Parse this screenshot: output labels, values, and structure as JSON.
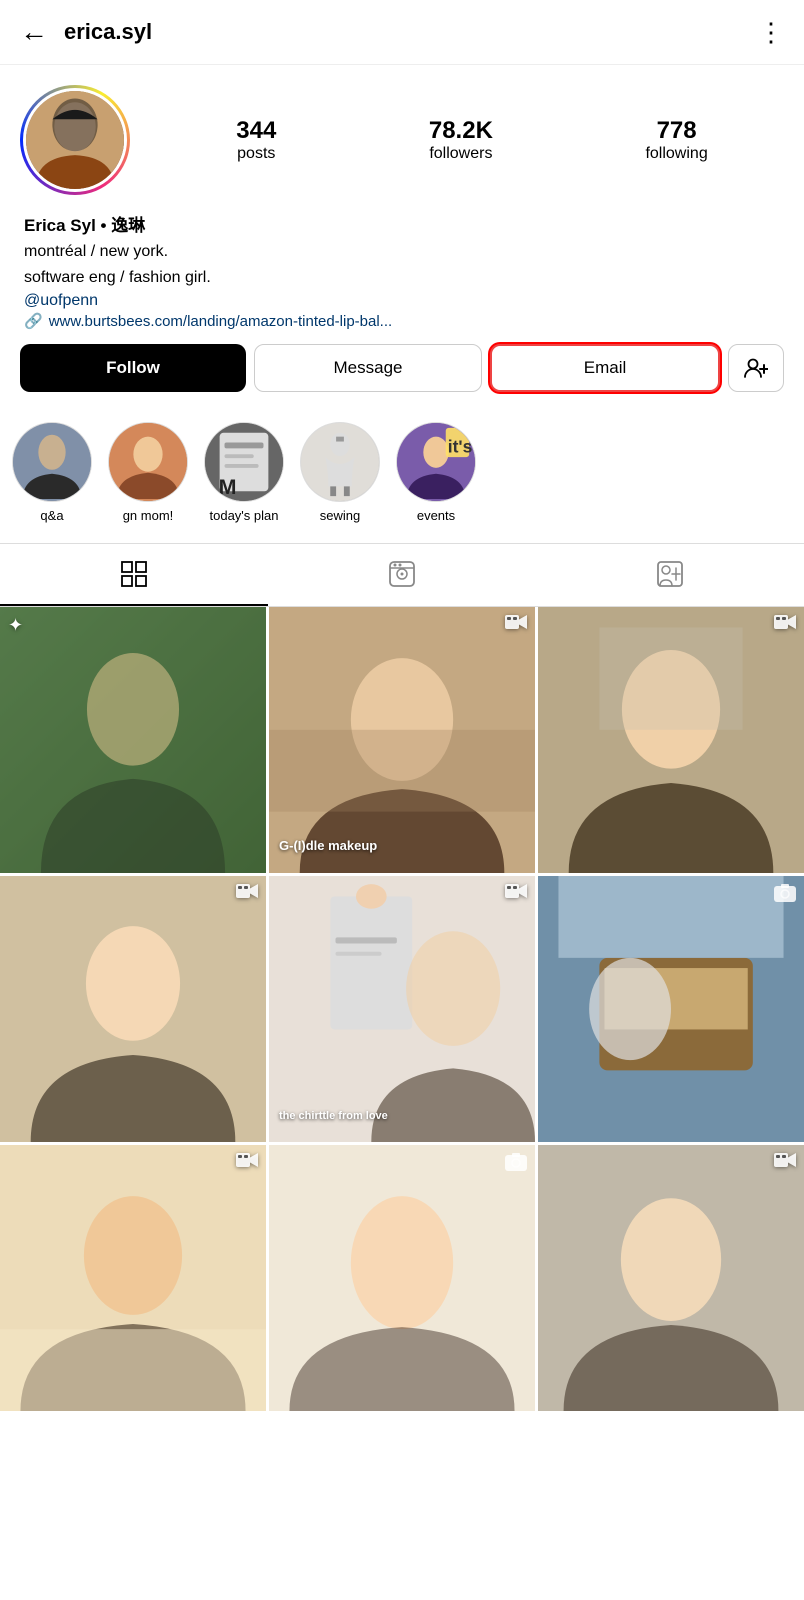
{
  "header": {
    "back_label": "←",
    "username": "erica.syl",
    "menu_label": "⋮"
  },
  "profile": {
    "display_name": "Erica Syl • 逸琳",
    "bio_line1": "montréal / new york.",
    "bio_line2": "software eng / fashion girl.",
    "bio_link1": "@uofpenn",
    "bio_url_icon": "🔗",
    "bio_url": "www.burtsbees.com/landing/amazon-tinted-lip-bal...",
    "stats": {
      "posts": {
        "number": "344",
        "label": "posts"
      },
      "followers": {
        "number": "78.2K",
        "label": "followers"
      },
      "following": {
        "number": "778",
        "label": "following"
      }
    }
  },
  "buttons": {
    "follow": "Follow",
    "message": "Message",
    "email": "Email",
    "add_friend_icon": "👤+"
  },
  "highlights": [
    {
      "id": "qa",
      "label": "q&a",
      "class": "hl-q"
    },
    {
      "id": "gnmom",
      "label": "gn mom!",
      "class": "hl-gn"
    },
    {
      "id": "todaysplan",
      "label": "today's plan",
      "class": "hl-tp"
    },
    {
      "id": "sewing",
      "label": "sewing",
      "class": "hl-sw"
    },
    {
      "id": "events",
      "label": "events",
      "class": "hl-ev"
    }
  ],
  "tabs": [
    {
      "id": "grid",
      "icon": "⊞",
      "active": true
    },
    {
      "id": "reels",
      "icon": "▶",
      "active": false
    },
    {
      "id": "tagged",
      "icon": "🖼",
      "active": false
    }
  ],
  "grid": [
    {
      "id": 1,
      "class": "g1",
      "has_sparkle": true,
      "has_video": false,
      "overlay_text": ""
    },
    {
      "id": 2,
      "class": "g2",
      "has_sparkle": false,
      "has_video": true,
      "overlay_text": "G-(I)dle makeup"
    },
    {
      "id": 3,
      "class": "g3",
      "has_sparkle": false,
      "has_video": true,
      "overlay_text": ""
    },
    {
      "id": 4,
      "class": "g4",
      "has_sparkle": false,
      "has_video": true,
      "overlay_text": ""
    },
    {
      "id": 5,
      "class": "g5",
      "has_sparkle": false,
      "has_video": true,
      "overlay_text": "the chirttle from love"
    },
    {
      "id": 6,
      "class": "g6",
      "has_sparkle": false,
      "has_video": false,
      "overlay_text": ""
    },
    {
      "id": 7,
      "class": "g7",
      "has_sparkle": false,
      "has_video": true,
      "overlay_text": ""
    },
    {
      "id": 8,
      "class": "g8",
      "has_sparkle": false,
      "has_video": false,
      "overlay_text": ""
    },
    {
      "id": 9,
      "class": "g9",
      "has_sparkle": false,
      "has_video": true,
      "overlay_text": ""
    }
  ]
}
